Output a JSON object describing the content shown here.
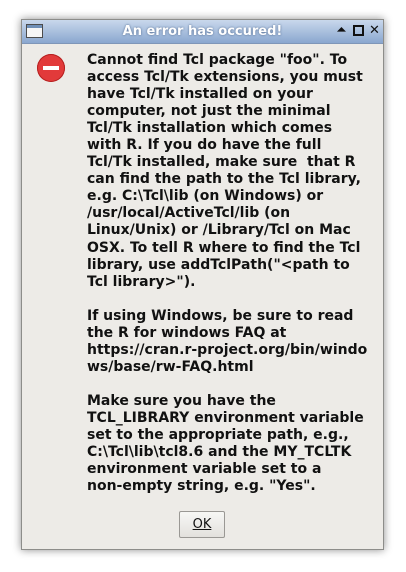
{
  "window": {
    "title": "An error has occured!",
    "shade_glyph": "⏶",
    "close_glyph": "✕"
  },
  "dialog": {
    "icon": "error-icon",
    "message": "Cannot find Tcl package \"foo\". To\naccess Tcl/Tk extensions, you must\nhave Tcl/Tk installed on your\ncomputer, not just the minimal\nTcl/Tk installation which comes\nwith R. If you do have the full\nTcl/Tk installed, make sure  that R\ncan find the path to the Tcl library,\ne.g. C:\\Tcl\\lib (on Windows) or\n/usr/local/ActiveTcl/lib (on\nLinux/Unix) or /Library/Tcl on Mac\nOSX. To tell R where to find the Tcl\nlibrary, use addTclPath(\"<path to\nTcl library>\").\n\nIf using Windows, be sure to read\nthe R for windows FAQ at\nhttps://cran.r-project.org/bin/windo\nws/base/rw-FAQ.html\n\nMake sure you have the\nTCL_LIBRARY environment variable\nset to the appropriate path, e.g.,\nC:\\Tcl\\lib\\tcl8.6 and the MY_TCLTK\nenvironment variable set to a\nnon-empty string, e.g. \"Yes\".",
    "ok_label": "OK"
  },
  "colors": {
    "titlebar_top": "#c9d8ec",
    "titlebar_bottom": "#8aa7cf",
    "dialog_bg": "#edebe7",
    "error_red": "#e23a3a"
  }
}
